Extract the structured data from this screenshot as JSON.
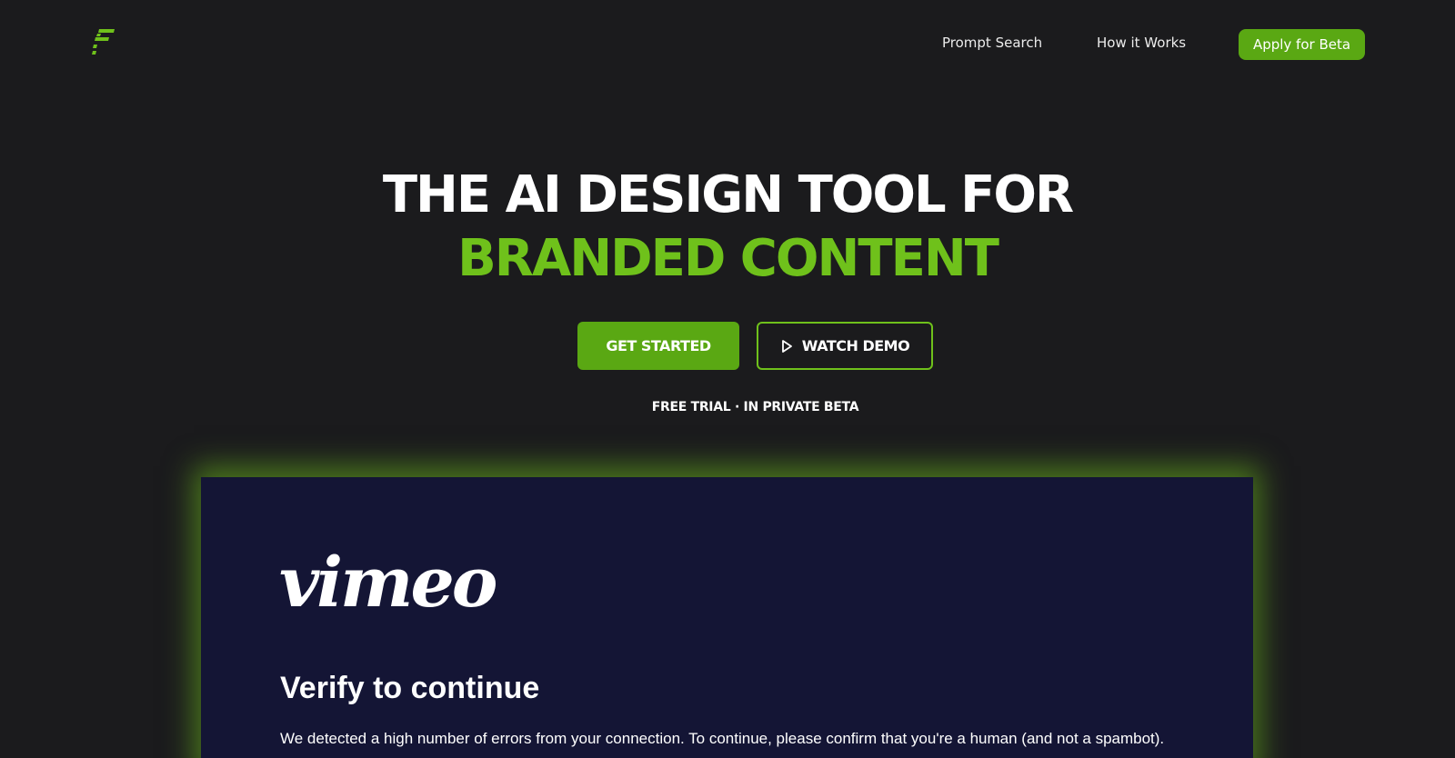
{
  "nav": {
    "logo_icon": "brand-f-stripes-icon",
    "links": [
      {
        "label": "Prompt Search"
      },
      {
        "label": "How it Works"
      }
    ],
    "cta_label": "Apply for Beta"
  },
  "hero": {
    "line1": "THE AI DESIGN TOOL FOR",
    "line2": "BRANDED CONTENT",
    "get_started_label": "GET STARTED",
    "watch_demo_label": "WATCH DEMO",
    "watch_demo_icon": "play-icon",
    "tagline": "FREE TRIAL · IN PRIVATE BETA"
  },
  "video": {
    "logo_text": "vimeo",
    "title": "Verify to continue",
    "message": "We detected a high number of errors from your connection. To continue, please confirm that you're a human (and not a spambot)."
  },
  "colors": {
    "background": "#1b1b1d",
    "accent": "#6fc11b",
    "button_green": "#5aa813",
    "video_background": "#141535"
  }
}
